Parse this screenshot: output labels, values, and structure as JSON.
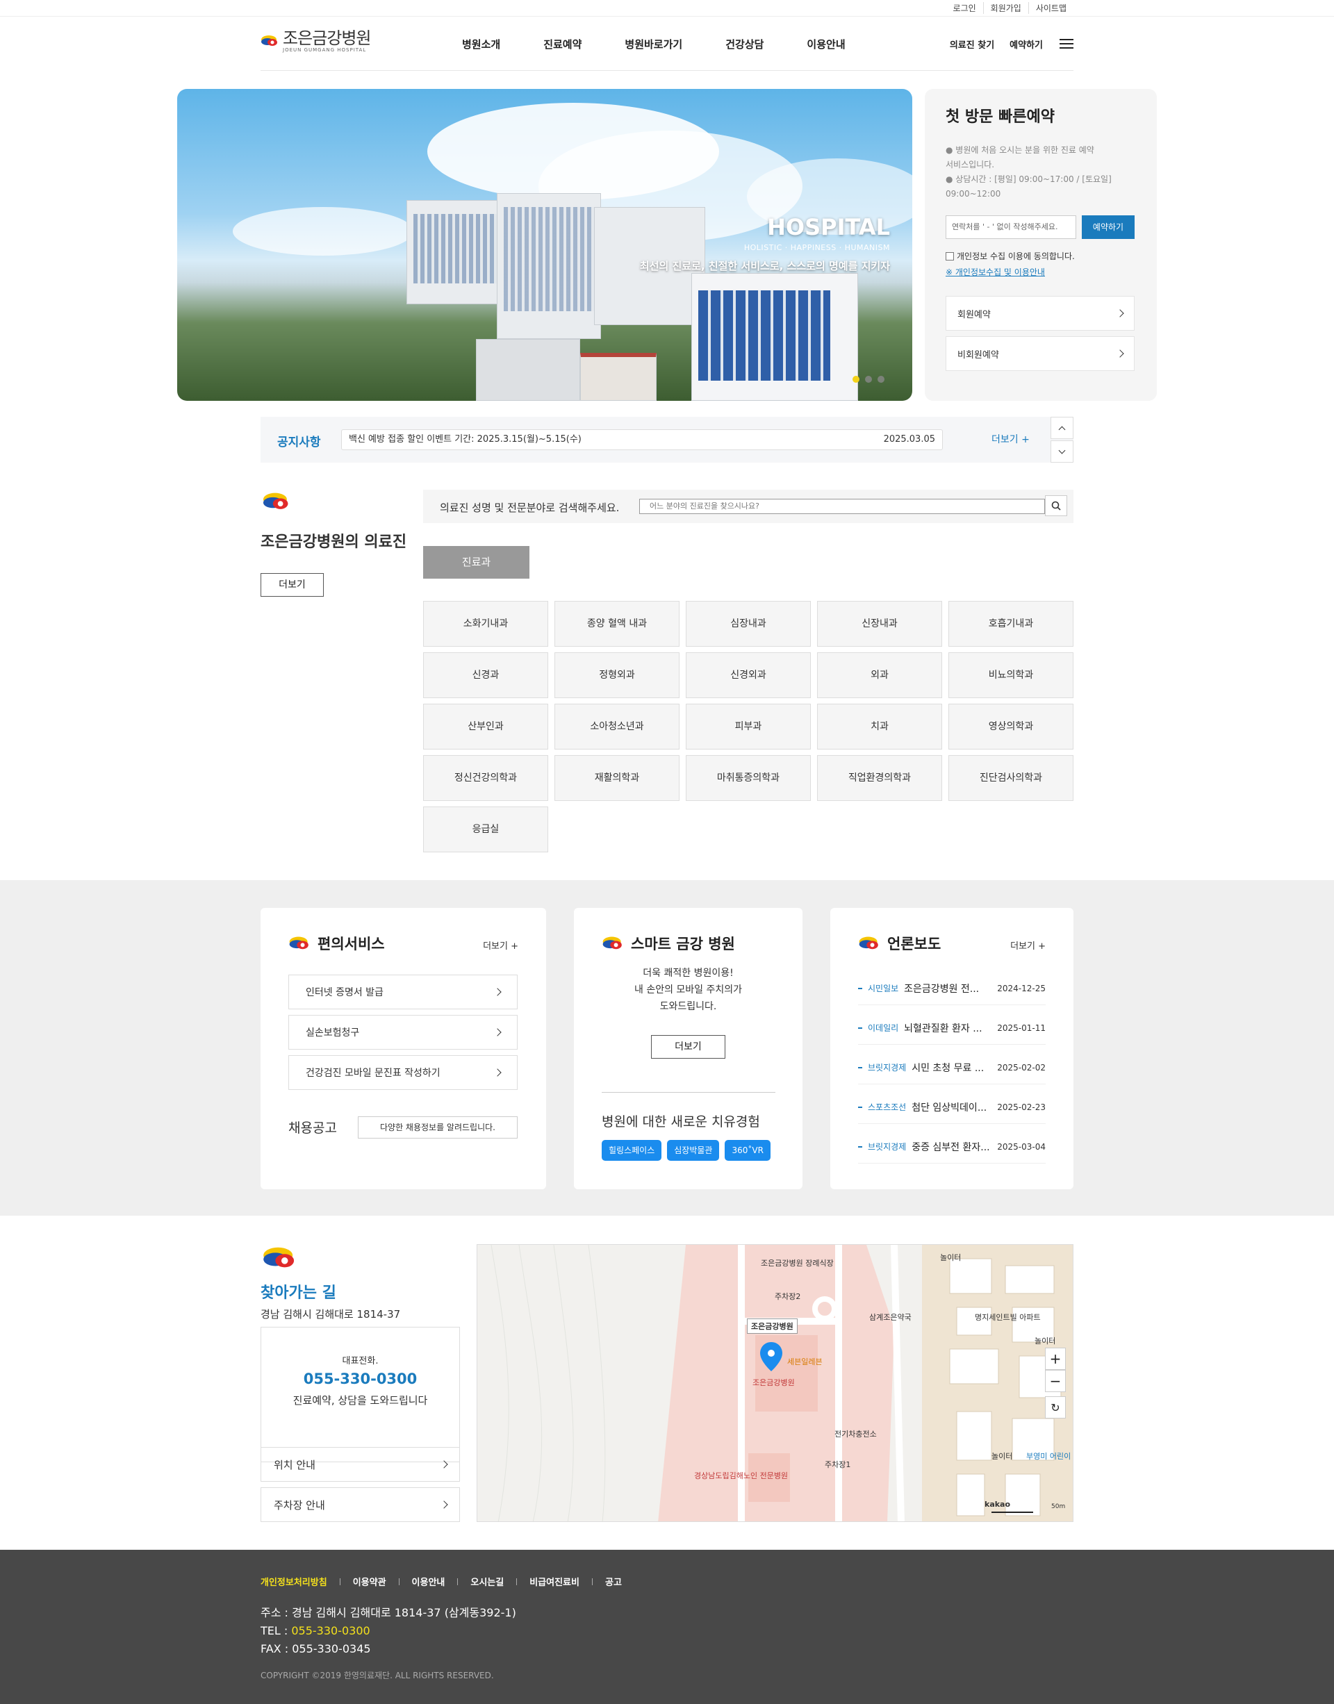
{
  "util": {
    "links": [
      "로그인",
      "회원가입",
      "사이트맵"
    ]
  },
  "header": {
    "logo_ko": "조은금강병원",
    "logo_en": "JOEUN GUMGANG HOSPITAL",
    "nav": [
      "병원소개",
      "진료예약",
      "병원바로가기",
      "건강상담",
      "이용안내"
    ],
    "right": [
      "의료진 찾기",
      "예약하기"
    ]
  },
  "hero": {
    "title": "HOSPITAL",
    "sub": "HOLISTIC · HAPPINESS · HUMANISM",
    "copy": "최선의 진료로, 친절한 서비스로, 스스로의 명예를 지키자",
    "slides": 3,
    "active_slide": 1
  },
  "reservation": {
    "title": "첫 방문 빠른예약",
    "desc1": "● 병원에 처음 오시는 분을 위한 진료 예약",
    "desc2": "서비스입니다.",
    "desc3": "● 상담시간 : [평일] 09:00~17:00 / [토요일]",
    "desc4": "09:00~12:00",
    "phone_placeholder": "연락처를 ' - ' 없이 작성해주세요.",
    "submit": "예약하기",
    "agree": "개인정보 수집 이용에 동의합니다.",
    "policy_link": "※ 개인정보수집 및 이용안내",
    "member": "회원예약",
    "nonmember": "비회원예약"
  },
  "notice": {
    "label": "공지사항",
    "text": "백신 예방 접종 할인 이벤트 기간: 2025.3.15(월)~5.15(수)",
    "date": "2025.03.05",
    "more": "더보기 +"
  },
  "doctors": {
    "title": "조은금강병원의 의료진",
    "more": "더보기",
    "search_label": "의료진 성명 및 전문분야로 검색해주세요.",
    "search_placeholder": "어느 분야의 진료진을 찾으시나요?",
    "tab": "진료과",
    "departments": [
      "소화기내과",
      "종양 혈액 내과",
      "심장내과",
      "신장내과",
      "호흡기내과",
      "신경과",
      "정형외과",
      "신경외과",
      "외과",
      "비뇨의학과",
      "산부인과",
      "소아청소년과",
      "피부과",
      "치과",
      "영상의학과",
      "정신건강의학과",
      "재활의학과",
      "마취통증의학과",
      "직업환경의학과",
      "진단검사의학과",
      "응급실"
    ]
  },
  "services": {
    "title": "편의서비스",
    "more": "더보기 +",
    "items": [
      "인터넷 증명서 발급",
      "실손보험청구",
      "건강검진 모바일 문진표 작성하기"
    ],
    "recruit": "채용공고",
    "recruit_box": "다양한 채용정보를 알려드립니다."
  },
  "smart": {
    "title": "스마트 금강 병원",
    "line1": "더욱 쾌적한 병원이용!",
    "line2": "내 손안의 모바일 주치의가",
    "line3": "도와드립니다.",
    "more": "더보기",
    "heading": "병원에 대한 새로운 치유경험",
    "chips": [
      "힐링스페이스",
      "심장박물관",
      "360˚VR"
    ]
  },
  "press": {
    "title": "언론보도",
    "more": "더보기 +",
    "items": [
      {
        "source": "시민일보",
        "title": "조은금강병원 전...",
        "date": "2024-12-25"
      },
      {
        "source": "이데일리",
        "title": "뇌혈관질환 환자 ...",
        "date": "2025-01-11"
      },
      {
        "source": "브릿지경제",
        "title": "시민 초청 무료 ...",
        "date": "2025-02-02"
      },
      {
        "source": "스포츠조선",
        "title": "첨단 임상빅데이...",
        "date": "2025-02-23"
      },
      {
        "source": "브릿지경제",
        "title": "중증 심부전 환자...",
        "date": "2025-03-04"
      }
    ]
  },
  "directions": {
    "title": "찾아가는 길",
    "address": "경남 김해시 김해대로 1814-37",
    "tel_label": "대표전화.",
    "tel": "055-330-0300",
    "tel_desc": "진료예약, 상담을 도와드립니다",
    "location": "위치 안내",
    "parking": "주차장 안내"
  },
  "map": {
    "labels": [
      "조은금강병원 장례식장",
      "주차장2",
      "조은금강병원",
      "세븐일레븐",
      "조은금강병원",
      "삼계조은약국",
      "명지세인트빌 아파트",
      "전기차충전소",
      "주차장1",
      "경상남도립김해노인 전문병원",
      "놀이터",
      "놀이터",
      "놀이터",
      "부영미 어린이"
    ],
    "scale": "50m",
    "brand": "kakao"
  },
  "footer": {
    "links": [
      "개인정보처리방침",
      "이용약관",
      "이용안내",
      "오시는길",
      "비급여진료비",
      "공고"
    ],
    "addr_label": "주소 : ",
    "addr": "경남 김해시 김해대로 1814-37 (삼계동392-1)",
    "tel_label": "TEL : ",
    "tel": "055-330-0300",
    "fax_label": "FAX : ",
    "fax": "055-330-0345",
    "copyright": "COPYRIGHT ©2019 한영의료재단. ALL RIGHTS RESERVED."
  },
  "colors": {
    "accent": "#1a7bbd",
    "chip": "#1a8cee",
    "footer": "#484848",
    "highlight": "#f4e01c"
  }
}
